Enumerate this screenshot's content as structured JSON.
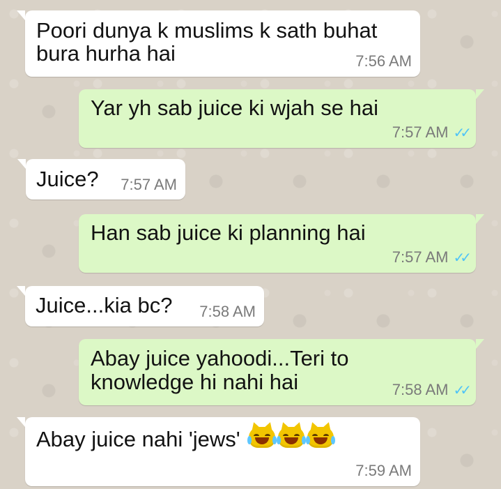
{
  "chat": {
    "messages": [
      {
        "direction": "incoming",
        "lines": [
          "Poori dunya k muslims k sath buhat",
          "bura hurha hai"
        ],
        "time": "7:56 AM"
      },
      {
        "direction": "outgoing",
        "lines": [
          "Yar yh sab juice ki wjah se hai"
        ],
        "time": "7:57 AM",
        "status_icon": "double-check-read-icon"
      },
      {
        "direction": "incoming",
        "lines": [
          "Juice?"
        ],
        "time": "7:57 AM"
      },
      {
        "direction": "outgoing",
        "lines": [
          "Han sab juice ki planning hai"
        ],
        "time": "7:57 AM",
        "status_icon": "double-check-read-icon"
      },
      {
        "direction": "incoming",
        "lines": [
          "Juice...kia bc?"
        ],
        "time": "7:58 AM"
      },
      {
        "direction": "outgoing",
        "lines": [
          "Abay juice yahoodi...Teri to",
          "knowledge hi nahi hai"
        ],
        "time": "7:58 AM",
        "status_icon": "double-check-read-icon"
      },
      {
        "direction": "incoming",
        "lines": [
          "Abay juice nahi 'jews'"
        ],
        "time": "7:59 AM",
        "emoji_icon": "cat-face-with-tears-of-joy-icon",
        "emoji_count": 3
      }
    ]
  },
  "colors": {
    "wallpaper": "#d9d2c7",
    "incoming_bubble": "#ffffff",
    "outgoing_bubble": "#dcf8c6",
    "read_check": "#4fc3f7",
    "timestamp": "#7a7a7a",
    "emoji": "#f2c500"
  }
}
